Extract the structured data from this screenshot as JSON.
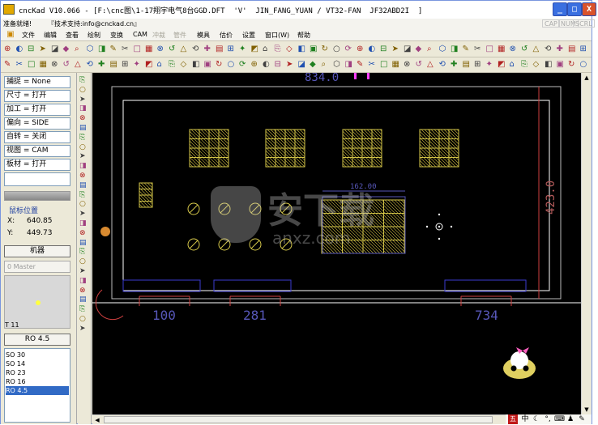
{
  "window": {
    "title": "cncKad V10.066 - [F:\\cnc图\\1-17翔宇电气8台GGD.DFT  'V'  JIN_FANG_YUAN / VT32-FAN  JF32ABD2I  ]",
    "minimize": "_",
    "maximize": "□",
    "close": "X",
    "icon": "cnckad-app-icon"
  },
  "status": {
    "ready": "准备就绪!",
    "support": "『技术支持:info@cnckad.cn』",
    "indicators": [
      "CAP",
      "NUM",
      "SCRL"
    ]
  },
  "menu": [
    "文件",
    "编辑",
    "查看",
    "绘制",
    "变换",
    "CAM",
    "冲裁",
    "管件",
    "模具",
    "估价",
    "设置",
    "窗口(W)",
    "帮助"
  ],
  "menu_disabled": [
    "冲裁",
    "管件"
  ],
  "left_panel": {
    "settings": [
      {
        "label": "捕捉 = None"
      },
      {
        "label": "尺寸 = 打开"
      },
      {
        "label": "加工 = 打开"
      },
      {
        "label": "偏向 = SIDE"
      },
      {
        "label": "自转 = 关闭"
      },
      {
        "label": "视图 = CAM"
      },
      {
        "label": "板材 = 打开"
      }
    ],
    "mouse_pos_title": "鼠标位置",
    "x_label": "X:",
    "x_value": "640.85",
    "y_label": "Y:",
    "y_value": "449.73",
    "machine_button": "机器",
    "master_select": "0 Master",
    "tool_id": "T 11",
    "current_tool_button": "RO 4.5",
    "tool_list": [
      "SO 30",
      "SO 14",
      "RO 23",
      "RO 16",
      "RO 4.5"
    ],
    "tool_list_selected": "RO 4.5"
  },
  "canvas": {
    "dim_top": "834.0",
    "dim_right": "423.0",
    "dim_inner": "162.00",
    "dim_bottom": [
      "100",
      "281",
      "734"
    ],
    "colors": {
      "background": "#000000",
      "outline": "#ffffff",
      "clamp": "#3b3bd0",
      "punch": "#d6c84a",
      "dimension": "#5757b8",
      "dim_right": "#b35a5a"
    }
  },
  "watermark": {
    "text": "安下载",
    "sub": "anxz.com"
  },
  "tray": {
    "ime": "中",
    "items": [
      "ime-icon",
      "moon-icon",
      "keyboard-icon",
      "settings-icon"
    ]
  }
}
